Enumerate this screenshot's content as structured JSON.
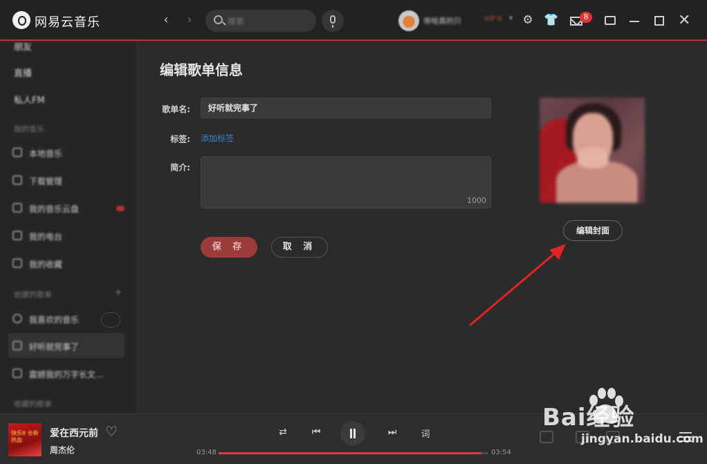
{
  "app": {
    "brand": "网易云音乐",
    "search_placeholder": "搜索",
    "username": "帝哈真的只",
    "vip": "VIP 6",
    "mail_count": "8",
    "icons": [
      "logo-icon",
      "back-icon",
      "forward-icon",
      "search-icon",
      "mic-icon",
      "gear-icon",
      "shirt-icon",
      "mail-icon",
      "mini-mode-icon",
      "minimize-icon",
      "maximize-icon",
      "close-icon"
    ]
  },
  "sidebar": {
    "top_items": [
      "朋友",
      "直播",
      "私人FM"
    ],
    "section_my_music": "我的音乐",
    "my_music_items": [
      "本地音乐",
      "下载管理",
      "我的音乐云盘",
      "我的电台",
      "我的收藏"
    ],
    "section_created": "创建的歌单",
    "created_items": [
      "我喜欢的音乐",
      "好听就完事了",
      "震撼我的万字长文..."
    ],
    "section_collected": "收藏的歌单"
  },
  "form": {
    "title": "编辑歌单信息",
    "name_label": "歌单名:",
    "name_value": "好听就完事了",
    "tag_label": "标签:",
    "add_tag": "添加标签",
    "intro_label": "简介:",
    "intro_counter": "1000",
    "save": "保 存",
    "cancel": "取 消",
    "edit_cover": "编辑封面"
  },
  "player": {
    "song": "爱在西元前",
    "artist": "周杰伦",
    "time_current": "03:48",
    "time_total": "03:54",
    "progress": 0.975,
    "lyric": "词",
    "album_text": "快乐8 全新热血"
  },
  "watermark": {
    "text": "Bai经验",
    "url": "jingyan.baidu.com"
  },
  "colors": {
    "accent": "#c62f2f",
    "link": "#3f7fd0",
    "save_button": "#9c3b3b",
    "arrow": "#e02424"
  }
}
